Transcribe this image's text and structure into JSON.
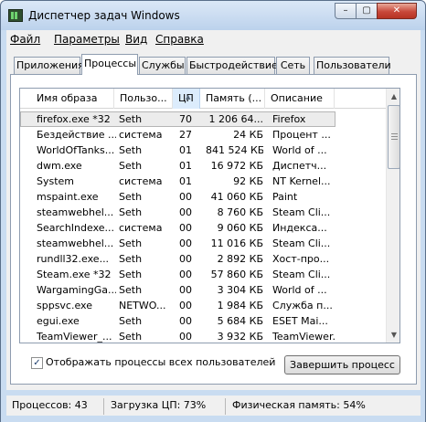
{
  "window": {
    "title": "Диспетчер задач Windows",
    "controls": {
      "minimize": "–",
      "maximize": "▢",
      "close": "✕"
    }
  },
  "menu": [
    {
      "label": "Файл"
    },
    {
      "label": "Параметры"
    },
    {
      "label": "Вид"
    },
    {
      "label": "Справка"
    }
  ],
  "tabs": [
    {
      "label": "Приложения",
      "active": false
    },
    {
      "label": "Процессы",
      "active": true
    },
    {
      "label": "Службы",
      "active": false
    },
    {
      "label": "Быстродействие",
      "active": false
    },
    {
      "label": "Сеть",
      "active": false
    },
    {
      "label": "Пользователи",
      "active": false
    }
  ],
  "table": {
    "columns": [
      "Имя образа",
      "Пользо...",
      "ЦП",
      "Память (...",
      "Описание"
    ],
    "sorted_column": "ЦП",
    "rows": [
      {
        "name": "firefox.exe *32",
        "user": "Seth",
        "cpu": "70",
        "mem": "1 206 64...",
        "desc": "Firefox",
        "selected": true
      },
      {
        "name": "Бездействие ...",
        "user": "система",
        "cpu": "27",
        "mem": "24 КБ",
        "desc": "Процент ..."
      },
      {
        "name": "WorldOfTanks...",
        "user": "Seth",
        "cpu": "01",
        "mem": "841 524 КБ",
        "desc": "World of ..."
      },
      {
        "name": "dwm.exe",
        "user": "Seth",
        "cpu": "01",
        "mem": "16 972 КБ",
        "desc": "Диспетч..."
      },
      {
        "name": "System",
        "user": "система",
        "cpu": "01",
        "mem": "92 КБ",
        "desc": "NT Kernel..."
      },
      {
        "name": "mspaint.exe",
        "user": "Seth",
        "cpu": "00",
        "mem": "41 060 КБ",
        "desc": "Paint"
      },
      {
        "name": "steamwebhel...",
        "user": "Seth",
        "cpu": "00",
        "mem": "8 760 КБ",
        "desc": "Steam Cli..."
      },
      {
        "name": "SearchIndexe...",
        "user": "система",
        "cpu": "00",
        "mem": "9 060 КБ",
        "desc": "Индекса..."
      },
      {
        "name": "steamwebhel...",
        "user": "Seth",
        "cpu": "00",
        "mem": "11 016 КБ",
        "desc": "Steam Cli..."
      },
      {
        "name": "rundll32.exe...",
        "user": "Seth",
        "cpu": "00",
        "mem": "2 892 КБ",
        "desc": "Хост-про..."
      },
      {
        "name": "Steam.exe *32",
        "user": "Seth",
        "cpu": "00",
        "mem": "57 860 КБ",
        "desc": "Steam Cli..."
      },
      {
        "name": "WargamingGa...",
        "user": "Seth",
        "cpu": "00",
        "mem": "3 304 КБ",
        "desc": "World of ..."
      },
      {
        "name": "sppsvc.exe",
        "user": "NETWO...",
        "cpu": "00",
        "mem": "1 984 КБ",
        "desc": "Служба п..."
      },
      {
        "name": "egui.exe",
        "user": "Seth",
        "cpu": "00",
        "mem": "5 684 КБ",
        "desc": "ESET Mai..."
      },
      {
        "name": "TeamViewer_...",
        "user": "Seth",
        "cpu": "00",
        "mem": "3 932 КБ",
        "desc": "TeamViewer..."
      }
    ]
  },
  "show_all_users": {
    "label": "Отображать процессы всех пользователей",
    "checked": true,
    "mark": "✓"
  },
  "end_process_button": "Завершить процесс",
  "status": {
    "processes": "Процессов: 43",
    "cpu": "Загрузка ЦП: 73%",
    "memory": "Физическая память: 54%"
  }
}
